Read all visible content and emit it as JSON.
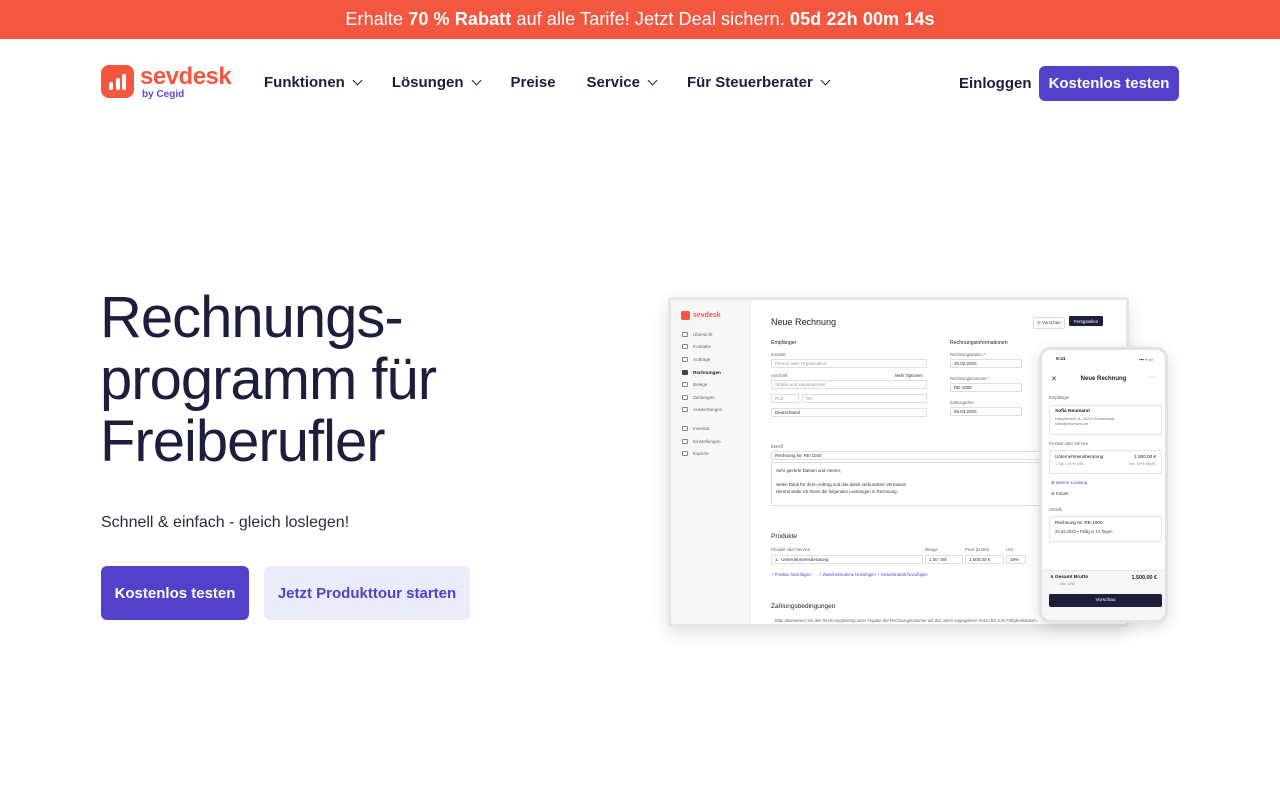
{
  "promo": {
    "prefix": "Erhalte ",
    "highlight": "70 % Rabatt",
    "middle": " auf alle Tarife! Jetzt Deal sichern. ",
    "countdown": "05d 22h 00m 14s"
  },
  "brand": {
    "name": "sevdesk",
    "sub": "by Cegid",
    "color": "#f4573f"
  },
  "nav": {
    "items": [
      {
        "label": "Funktionen",
        "dropdown": true
      },
      {
        "label": "Lösungen",
        "dropdown": true
      },
      {
        "label": "Preise",
        "dropdown": false
      },
      {
        "label": "Service",
        "dropdown": true
      },
      {
        "label": "Für Steuerberater",
        "dropdown": true
      }
    ],
    "login": "Einloggen",
    "cta": "Kostenlos testen"
  },
  "hero": {
    "title_lines": [
      "Rechnungs-",
      "programm für",
      "Freiberufler"
    ],
    "subtitle": "Schnell & einfach - gleich loslegen!",
    "primary_button": "Kostenlos testen",
    "secondary_button": "Jetzt Produkttour starten"
  },
  "colors": {
    "accent": "#5342c9",
    "accent_soft": "#ecebfb",
    "promo": "#f4573f",
    "text": "#1e1e3c"
  },
  "mockup": {
    "logo": "sevdesk",
    "sidebar": [
      {
        "label": "Übersicht",
        "active": false
      },
      {
        "label": "Kontakte",
        "active": false
      },
      {
        "label": "Aufträge",
        "active": false
      },
      {
        "label": "Rechnungen",
        "active": true
      },
      {
        "label": "Belege",
        "active": false
      },
      {
        "label": "Zahlungen",
        "active": false
      },
      {
        "label": "Auswertungen",
        "active": false
      },
      {
        "label": "Inventar",
        "active": false,
        "gap": true
      },
      {
        "label": "Einstellungen",
        "active": false
      },
      {
        "label": "Exporte",
        "active": false
      }
    ],
    "title": "Neue Rechnung",
    "preview": "Vorschau",
    "save": "Fertigstellen",
    "recipient": {
      "heading": "Empfänger",
      "contact_label": "Kontakt",
      "contact_placeholder": "Person oder Organisation",
      "address_label": "Anschrift",
      "more_options": "Mehr Optionen",
      "street_placeholder": "Straße und Hausnummer",
      "zip_placeholder": "PLZ",
      "city_placeholder": "Ort",
      "country": "Deutschland"
    },
    "invoice_info": {
      "heading": "Rechnungsinformationen",
      "date_label": "Rechnungsdatum *",
      "date": "20.02.2020",
      "number_label": "Rechnungsnummer *",
      "number": "RE-1000",
      "due_label": "Zahlungsziel",
      "due": "06.03.2020"
    },
    "subject_label": "Betreff",
    "subject": "Rechnung Nr. RE-1040",
    "body_lines": [
      "Sehr geehrte Damen und Herren,",
      "",
      "vielen Dank für Ihren Auftrag und das damit verbundene Vertrauen!",
      "Hiermit stelle ich Ihnen die folgenden Leistungen in Rechnung:"
    ],
    "products": {
      "heading": "Produkte",
      "col_product": "Produkt oder Service",
      "col_qty": "Menge",
      "col_price": "Preis (brutto)",
      "col_tax": "USt.",
      "row_index": "1.",
      "row_name": "Unternehmensberatung",
      "row_qty": "1,00",
      "row_unit": "Stk",
      "row_price": "1.500,00 €",
      "row_tax": "19%",
      "links": [
        "+ Position hinzufügen",
        "+ Zwischensumme hinzufügen",
        "+ Gesamtrabatt hinzufügen"
      ]
    },
    "payment": {
      "heading": "Zahlungsbedingungen",
      "text": "Bitte überweisen Sie den Rechnungsbetrag unter Angabe der Rechnungsnummer auf das unten angegebene Konto bis zum Fälligkeitsdatum."
    }
  },
  "phone": {
    "time": "9:41",
    "signal": "▪▪▪ ≈ ▭",
    "title": "Neue Rechnung",
    "recipient_label": "Empfänger",
    "recipient_name": "Sofia Neumann",
    "recipient_address": "Hauptstraße 11, 10243 Musterstadt",
    "recipient_email": "sofia@neumann.de",
    "product_label": "Produkt oder Service",
    "product_name": "Unternehmensberatung",
    "product_price": "1.500,00 €",
    "product_meta": "1 Stk • 19 % USt.",
    "product_net": "inkl. 19% MwSt.",
    "add_service": "⊕ weitere Leistung",
    "discount": "⊕ Rabatt",
    "details_label": "Details",
    "invoice_title": "Rechnung Nr. RE-1000",
    "invoice_meta": "20.02.2020  •  Fällig in 14 Tagen",
    "total_label": "Gesamt Brutto",
    "total_sub": "inkl. USt.",
    "total_value": "1.500,00 €",
    "preview_button": "Vorschau"
  }
}
